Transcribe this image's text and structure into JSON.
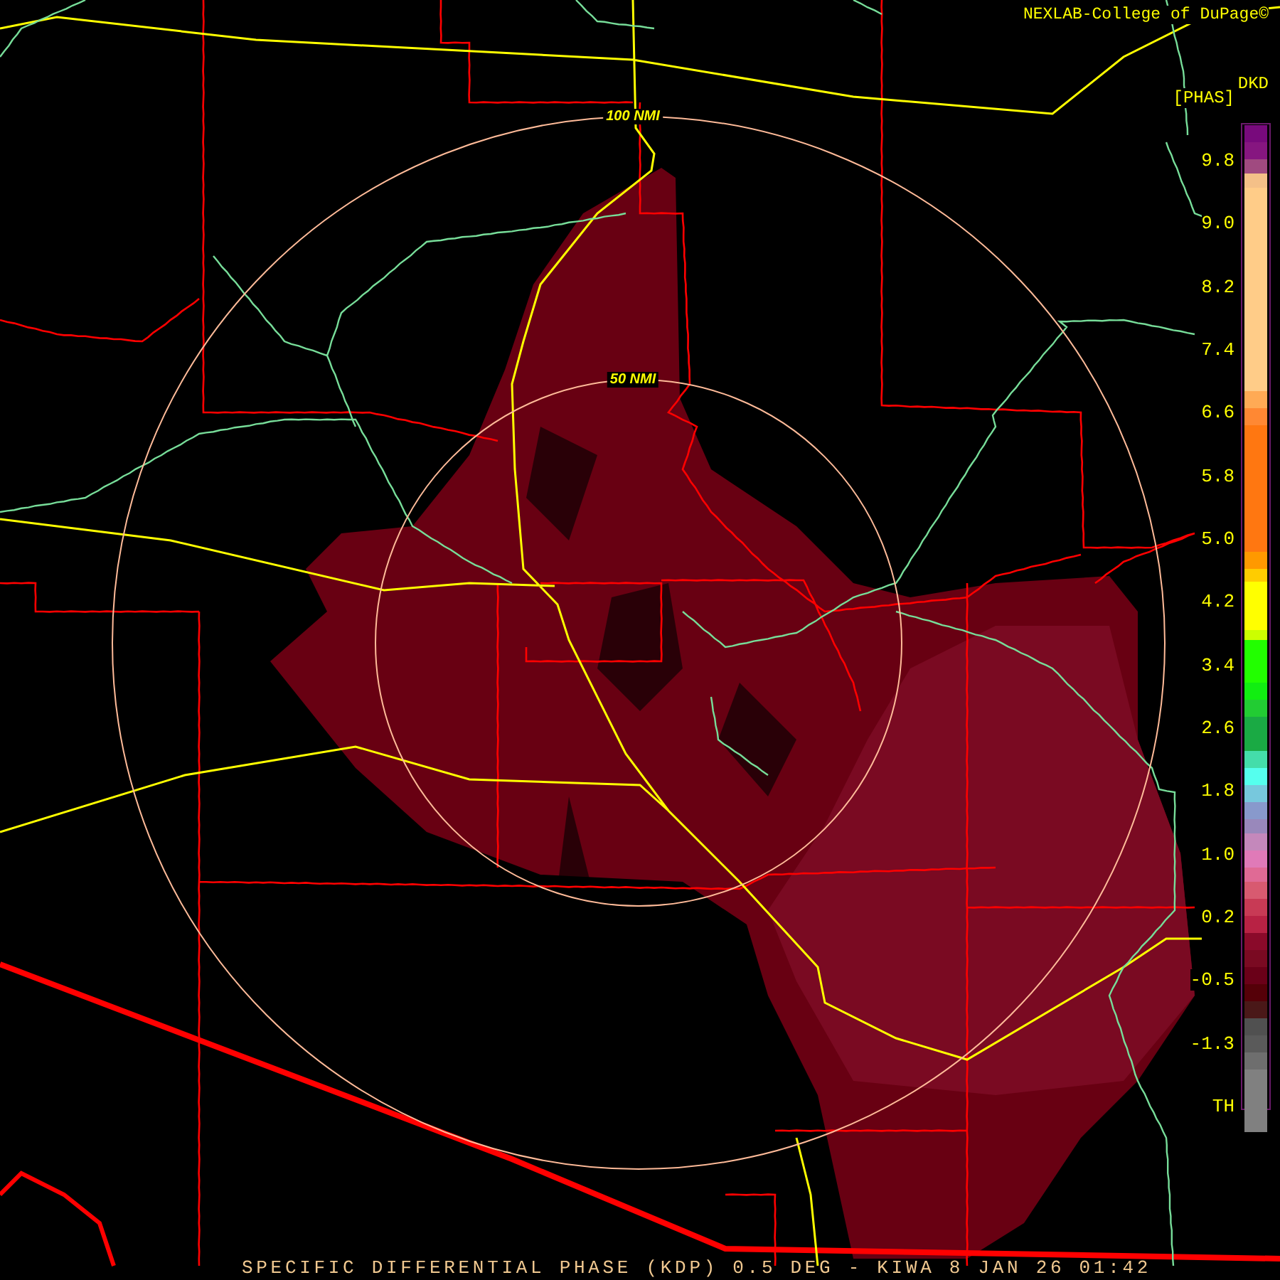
{
  "header": {
    "credit": "NEXLAB-College of DuPage©",
    "station": "DKD",
    "unit": "[PHAS]"
  },
  "map": {
    "rings": [
      {
        "label": "100 NMI"
      },
      {
        "label": "50 NMI"
      }
    ]
  },
  "legend": {
    "labels": [
      "9.8",
      "9.0",
      "8.2",
      "7.4",
      "6.6",
      "5.8",
      "5.0",
      "4.2",
      "3.4",
      "2.6",
      "1.8",
      "1.0",
      "0.2",
      "-0.5",
      "-1.3",
      "TH"
    ]
  },
  "caption": "SPECIFIC DIFFERENTIAL PHASE (KDP) 0.5 DEG - KIWA 8 JAN 26 01:42"
}
